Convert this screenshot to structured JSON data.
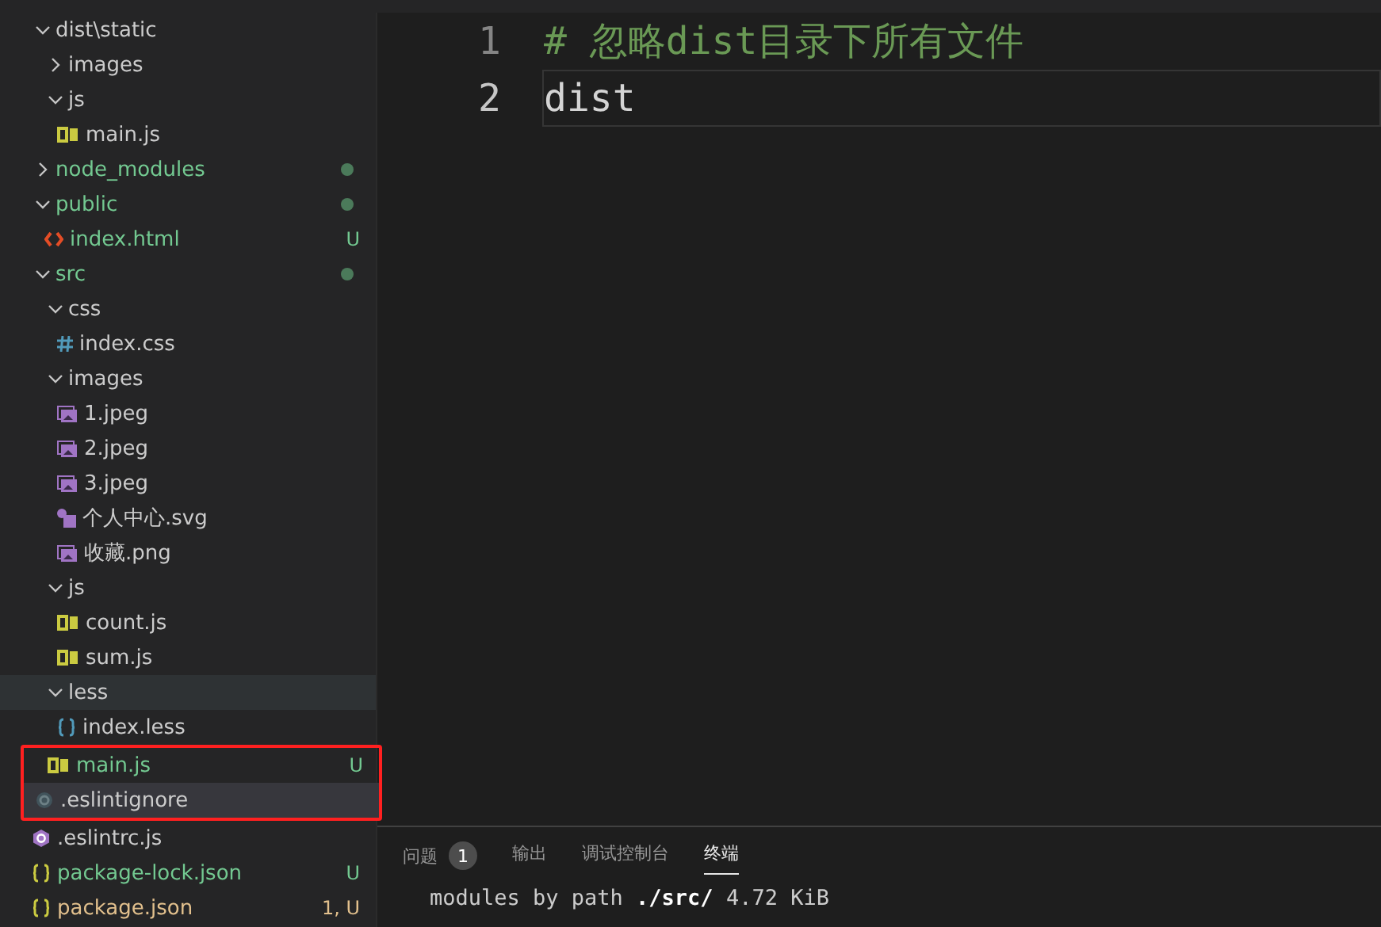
{
  "explorer": {
    "items": [
      {
        "name": "dist\\static",
        "kind": "folder",
        "expanded": true,
        "children": [
          {
            "name": "images",
            "kind": "folder",
            "expanded": false
          },
          {
            "name": "js",
            "kind": "folder",
            "expanded": true,
            "children": [
              {
                "name": "main.js",
                "kind": "js"
              }
            ]
          }
        ]
      },
      {
        "name": "node_modules",
        "kind": "folder",
        "expanded": false,
        "color": "#73c991",
        "dot": true
      },
      {
        "name": "public",
        "kind": "folder",
        "expanded": true,
        "color": "#73c991",
        "dot": true,
        "children": [
          {
            "name": "index.html",
            "kind": "html",
            "color": "#73c991",
            "badge": "U"
          }
        ]
      },
      {
        "name": "src",
        "kind": "folder",
        "expanded": true,
        "color": "#73c991",
        "dot": true,
        "children": [
          {
            "name": "css",
            "kind": "folder",
            "expanded": true,
            "children": [
              {
                "name": "index.css",
                "kind": "css"
              }
            ]
          },
          {
            "name": "images",
            "kind": "folder",
            "expanded": true,
            "children": [
              {
                "name": "1.jpeg",
                "kind": "image"
              },
              {
                "name": "2.jpeg",
                "kind": "image"
              },
              {
                "name": "3.jpeg",
                "kind": "image"
              },
              {
                "name": "个人中心.svg",
                "kind": "svg"
              },
              {
                "name": "收藏.png",
                "kind": "image"
              }
            ]
          },
          {
            "name": "js",
            "kind": "folder",
            "expanded": true,
            "children": [
              {
                "name": "count.js",
                "kind": "js"
              },
              {
                "name": "sum.js",
                "kind": "js"
              }
            ]
          },
          {
            "name": "less",
            "kind": "folder",
            "expanded": true,
            "hovered": true,
            "children": [
              {
                "name": "index.less",
                "kind": "less"
              }
            ]
          },
          {
            "name": "main.js",
            "kind": "js",
            "color": "#73c991",
            "badge": "U",
            "boxed": true
          }
        ]
      },
      {
        "name": ".eslintignore",
        "kind": "ignore",
        "selected": true,
        "boxed": true
      },
      {
        "name": ".eslintrc.js",
        "kind": "eslint"
      },
      {
        "name": "package-lock.json",
        "kind": "json",
        "color": "#73c991",
        "badge": "U"
      },
      {
        "name": "package.json",
        "kind": "json",
        "color": "#e2c08d",
        "badge": "1, U"
      }
    ]
  },
  "editor": {
    "lines": [
      {
        "number": "1",
        "kind": "comment",
        "text": "# 忽略dist目录下所有文件",
        "current": false
      },
      {
        "number": "2",
        "kind": "plain",
        "text": "dist",
        "current": true
      }
    ]
  },
  "panel": {
    "tabs": [
      {
        "label": "问题",
        "count": "1",
        "selected": false
      },
      {
        "label": "输出",
        "selected": false
      },
      {
        "label": "调试控制台",
        "selected": false
      },
      {
        "label": "终端",
        "selected": true
      }
    ],
    "terminal": [
      "modules by path **./src/** 4.72 KiB"
    ]
  }
}
